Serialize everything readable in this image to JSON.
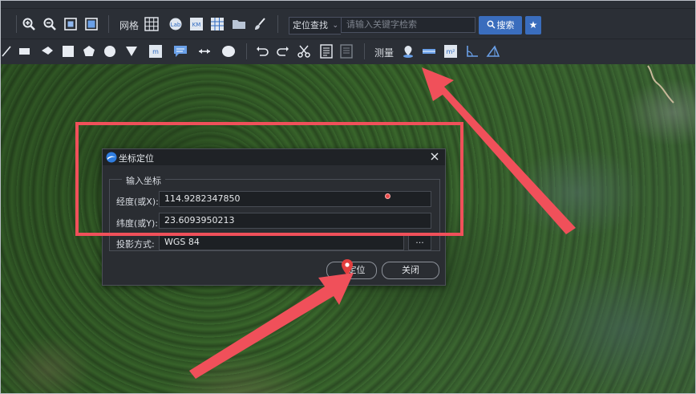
{
  "toolbar1": {
    "grid_label": "网格",
    "search_type": "定位查找",
    "search_placeholder": "请输入关键字检索",
    "search_button": "搜索"
  },
  "toolbar2": {
    "measure_label": "测量"
  },
  "dialog": {
    "title": "坐标定位",
    "group_title": "输入坐标",
    "longitude_label": "经度(或X):",
    "longitude_value": "114.9282347850",
    "latitude_label": "纬度(或Y):",
    "latitude_value": "23.6093950213",
    "projection_label": "投影方式:",
    "projection_value": "WGS 84",
    "more_button": "...",
    "locate_button": "定位",
    "close_button": "关闭"
  },
  "colors": {
    "accent": "#3a6dbd",
    "annotation": "#f0505a",
    "panel": "#2a2d32"
  },
  "icons": [
    "zoom-in-icon",
    "zoom-out-icon",
    "full-extent-icon",
    "fullscreen-icon",
    "grid-icon",
    "globe-icon",
    "kml-icon",
    "table-icon",
    "folder-icon",
    "brush-icon",
    "polyline-icon",
    "rectangle-icon",
    "arrow-icon",
    "square-icon",
    "pentagon-icon",
    "circle-icon",
    "triangle-icon",
    "label-icon",
    "comment-icon",
    "resize-icon",
    "ellipse-icon",
    "undo-icon",
    "redo-icon",
    "scissors-icon",
    "note-icon",
    "document-icon",
    "pin-icon",
    "distance-icon",
    "area-icon",
    "angle-icon",
    "height-icon",
    "star-icon",
    "search-icon",
    "close-icon",
    "app-logo-icon",
    "location-pin-icon"
  ]
}
